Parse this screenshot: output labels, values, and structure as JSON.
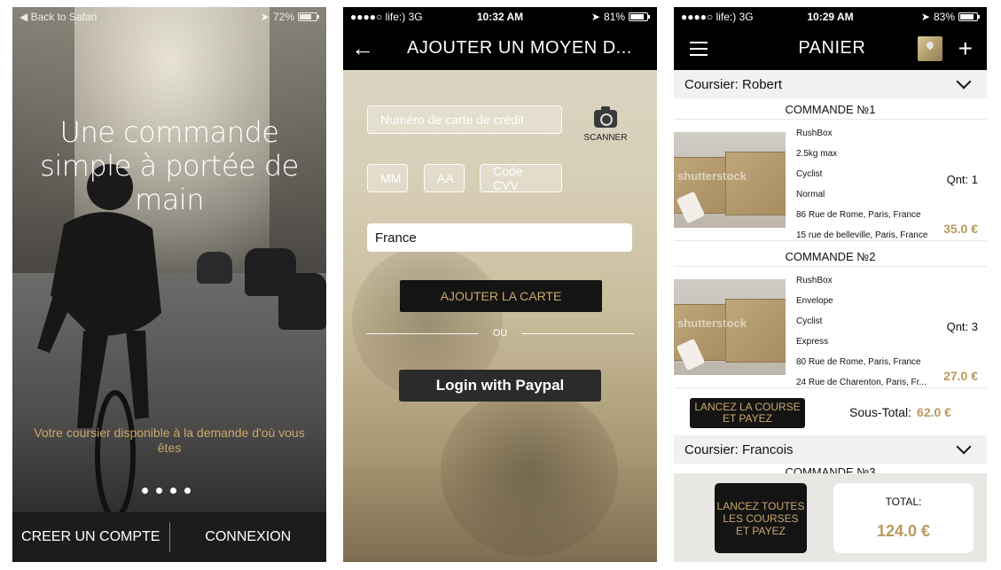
{
  "screen1": {
    "status": {
      "back_label": "◀ Back to Safari",
      "battery": "72%",
      "battery_level": 0.72
    },
    "headline": "Une commande simple à portée de main",
    "tagline": "Votre coursier disponible à la demande d'où vous êtes",
    "pager": {
      "count": 4
    },
    "buttons": {
      "create_account": "CREER UN COMPTE",
      "login": "CONNEXION"
    }
  },
  "screen2": {
    "status": {
      "carrier": "●●●●○ life:)  3G",
      "time": "10:32 AM",
      "battery": "81%",
      "battery_level": 0.81
    },
    "title": "AJOUTER UN MOYEN D...",
    "fields": {
      "card_placeholder": "Numéro de carte de crédit",
      "mm_placeholder": "MM",
      "aa_placeholder": "AA",
      "cvv_placeholder": "Code CVV",
      "country_value": "France"
    },
    "scanner_label": "SCANNER",
    "add_card_label": "AJOUTER LA CARTE",
    "or_label": "OU",
    "paypal_label": "Login with Paypal"
  },
  "screen3": {
    "status": {
      "carrier": "●●●●○ life:)  3G",
      "time": "10:29 AM",
      "battery": "83%",
      "battery_level": 0.83
    },
    "title": "PANIER",
    "couriers": [
      {
        "label": "Coursier: Robert",
        "orders": [
          {
            "title": "COMMANDE №1",
            "lines": [
              "RushBox",
              "2.5kg max",
              "Cyclist",
              "Normal",
              "86 Rue de Rome, Paris, France",
              "15 rue de belleville, Paris, France"
            ],
            "qty": "Qnt: 1",
            "price": "35.0 €"
          },
          {
            "title": "COMMANDE №2",
            "lines": [
              "RushBox",
              "Envelope",
              "Cyclist",
              "Express",
              "80 Rue de Rome, Paris, France",
              "24 Rue de Charenton, Paris, Fr..."
            ],
            "qty": "Qnt: 3",
            "price": "27.0 €"
          }
        ],
        "launch_label": "LANCEZ LA COURSE ET PAYEZ",
        "subtotal_label": "Sous-Total:",
        "subtotal_value": "62.0 €"
      },
      {
        "label": "Coursier: Francois"
      }
    ],
    "next_order_title": "COMMANDE №3",
    "footer": {
      "launch_all_label": "LANCEZ TOUTES LES COURSES ET PAYEZ",
      "total_label": "TOTAL:",
      "total_value": "124.0 €"
    }
  },
  "colors": {
    "gold": "#c9a86b",
    "price_gold": "#b8985e",
    "nav_black": "#000000"
  }
}
